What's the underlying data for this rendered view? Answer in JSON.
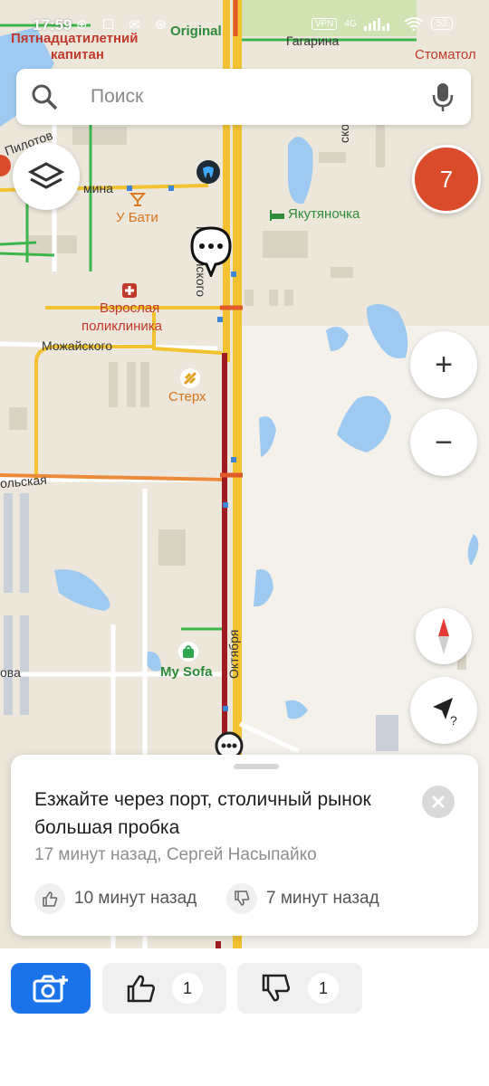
{
  "status_bar": {
    "time": "17:59",
    "icons": "⊕ ☐ ✉ ⊛",
    "vpn": "VPN",
    "network": "4G",
    "battery": "52"
  },
  "search": {
    "placeholder": "Поиск"
  },
  "traffic": {
    "level": "7",
    "color": "#d94b2b"
  },
  "map": {
    "labels": {
      "captain": "Пятнадцатилетний",
      "captain2": "капитан",
      "original": "Original",
      "gagarina": "Гагарина",
      "stomatolog": "Стоматол",
      "pilotov": "Пилотов",
      "mina": "мина",
      "u_bati": "У Бати",
      "yakutyanochka": "Якутяночка",
      "mozhayskogo_v": "Можайского",
      "polyclinic1": "Взрослая",
      "polyclinic2": "поликлиника",
      "mozhayskogo_h": "Можайского",
      "sterkh": "Стерх",
      "olskaya": "ольская",
      "my_sofa": "My Sofa",
      "ova": "ова",
      "oktyabrya": "Октября",
      "skogo": "ского"
    }
  },
  "controls": {
    "zoom_in": "+",
    "zoom_out": "−"
  },
  "card": {
    "message": "Езжайте через порт, столичный рынок большая пробка",
    "meta": "17 минут назад, Сергей Насыпайко",
    "like_time": "10 минут назад",
    "dislike_time": "7 минут назад"
  },
  "bottom": {
    "like_count": "1",
    "dislike_count": "1",
    "accent_color": "#1a73e8"
  }
}
